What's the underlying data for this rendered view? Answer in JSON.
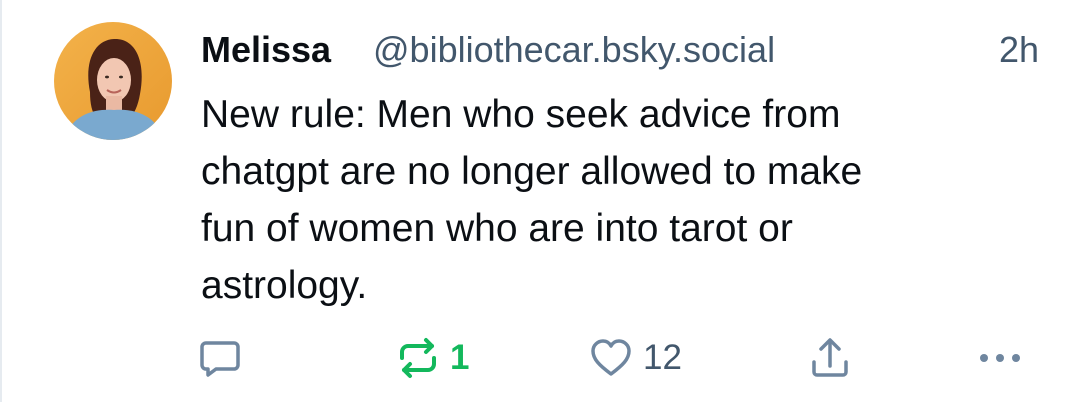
{
  "post": {
    "author_name": "Melissa",
    "author_handle": "@bibliothecar.bsky.social",
    "time": "2h",
    "text": "New rule: Men who seek advice from\nchatgpt are no longer allowed to make\nfun of women who are into tarot or\nastrology."
  },
  "actions": {
    "reply_icon": "reply-icon",
    "repost_icon": "repost-icon",
    "repost_count": "1",
    "like_icon": "heart-icon",
    "like_count": "12",
    "share_icon": "share-icon",
    "more_icon": "more-icon"
  },
  "colors": {
    "text": "#0b0f14",
    "muted": "#42576c",
    "icon": "#6f869f",
    "repost_active": "#13b85c",
    "border": "#e6ebf0"
  }
}
